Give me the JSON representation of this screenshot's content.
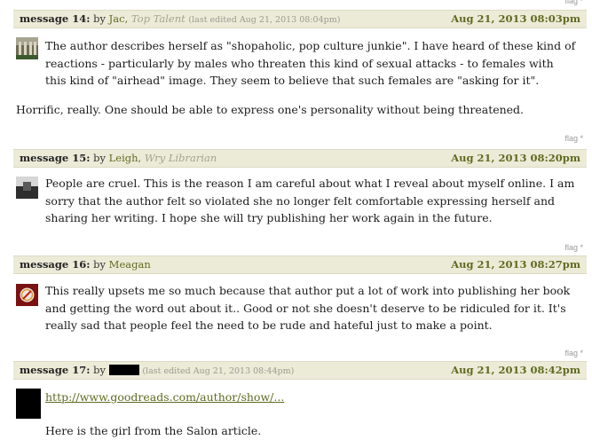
{
  "messages": [
    {
      "flag": "flag",
      "label": "message 14:",
      "by": "by",
      "user": "Jac,",
      "user_title": "Top Talent",
      "edited": "(last edited Aug 21, 2013 08:04pm)",
      "date": "Aug 21, 2013 08:03pm",
      "text": "The author describes herself as \"shopaholic, pop culture junkie\". I have heard of these kind of reactions - particularly by males who threaten this kind of sexual attacks - to females with this kind of \"airhead\" image. They seem to believe that such females are \"asking for it\".",
      "text2": "Horrific, really. One should be able to express one's personality without being threatened."
    },
    {
      "flag": "flag",
      "label": "message 15:",
      "by": "by",
      "user": "Leigh,",
      "user_title": "Wry Librarian",
      "date": "Aug 21, 2013 08:20pm",
      "text": "People are cruel. This is the reason I am careful about what I reveal about myself online. I am sorry that the author felt so violated she no longer felt comfortable expressing herself and sharing her writing. I hope she will try publishing her work again in the future."
    },
    {
      "flag": "flag",
      "label": "message 16:",
      "by": "by",
      "user": "Meagan",
      "date": "Aug 21, 2013 08:27pm",
      "text": "This really upsets me so much because that author put a lot of work into publishing her book and getting the word out about it.. Good or not she doesn't deserve to be ridiculed for it. It's really sad that people feel the need to be rude and hateful just to make a point."
    },
    {
      "flag": "flag",
      "label": "message 17:",
      "by": "by",
      "edited": "(last edited Aug 21, 2013 08:44pm)",
      "date": "Aug 21, 2013 08:42pm",
      "link": "http://www.goodreads.com/author/show/...",
      "text2": "Here is the girl from the Salon article."
    }
  ]
}
